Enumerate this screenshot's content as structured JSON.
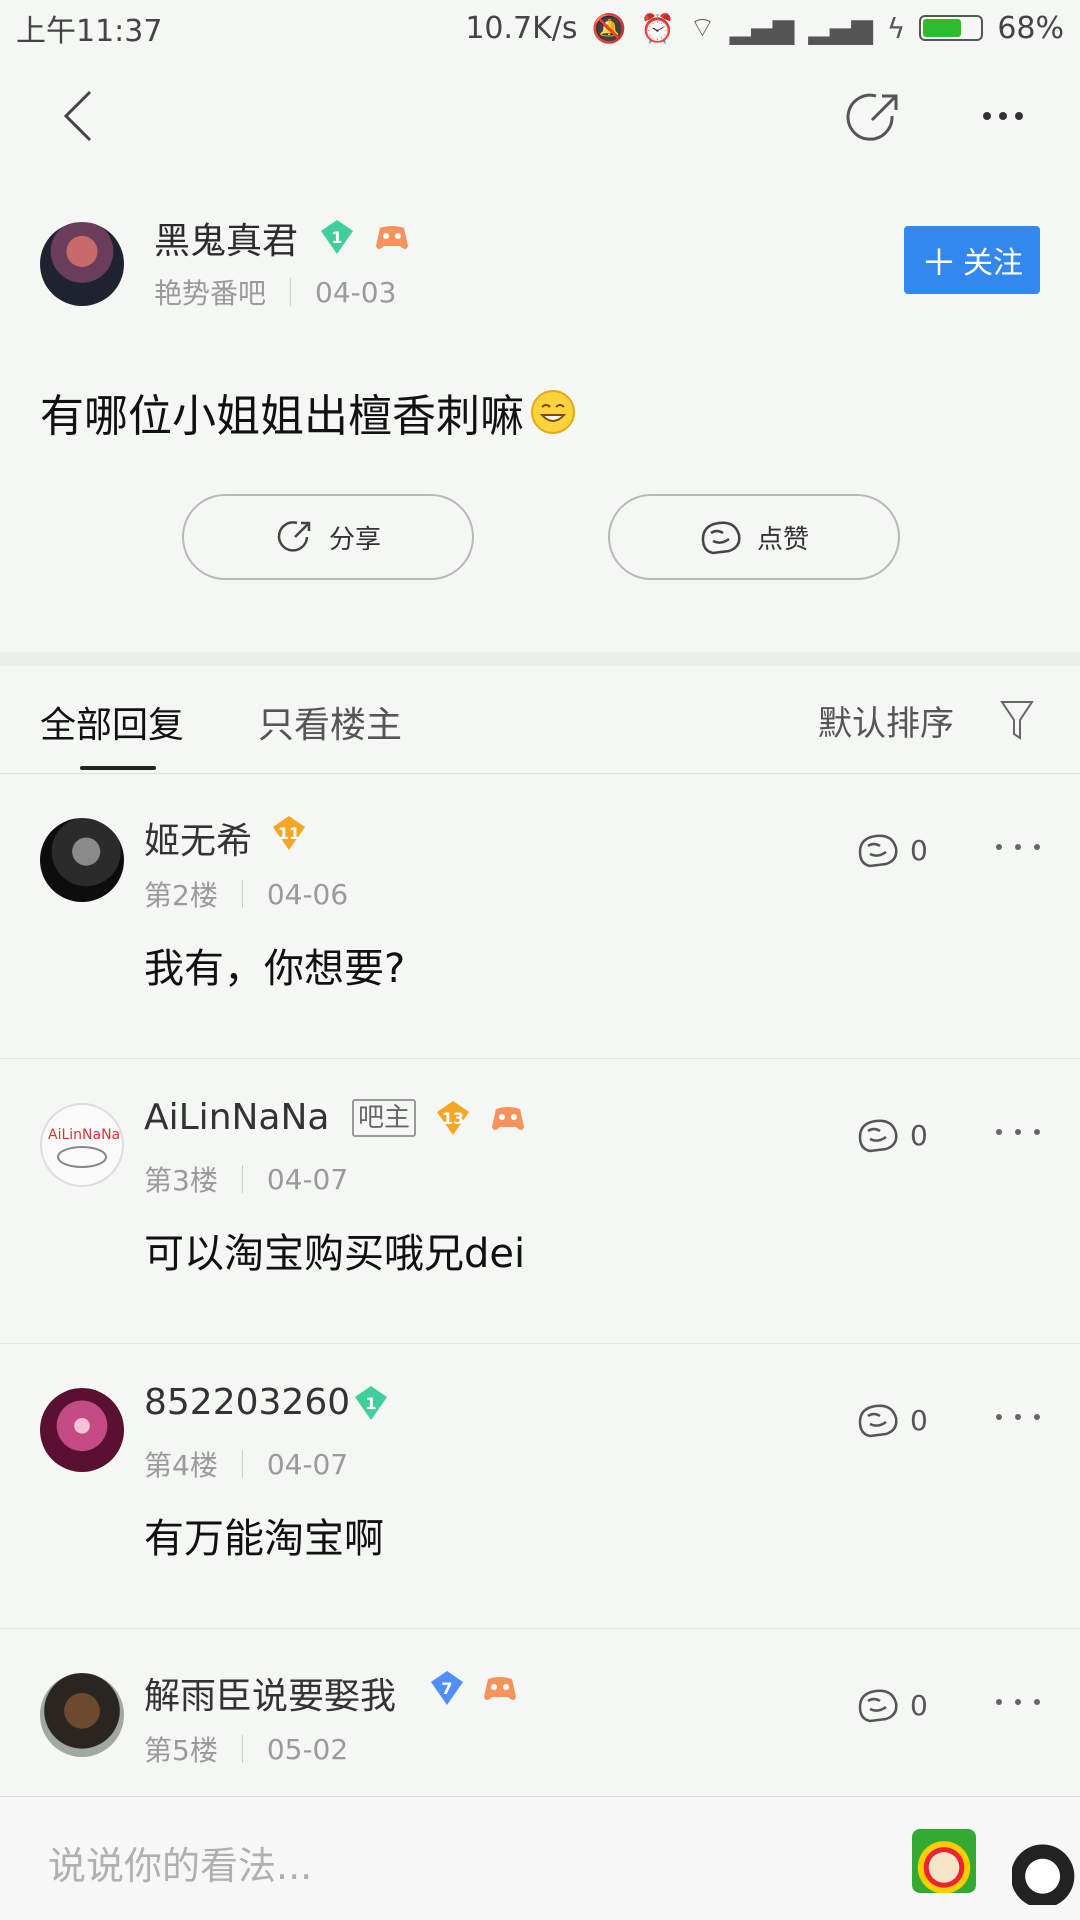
{
  "status_bar": {
    "time": "上午11:37",
    "speed": "10.7K/s",
    "battery": "68%",
    "battery_level": 0.68
  },
  "post": {
    "author": "黑鬼真君",
    "author_level": "1",
    "forum": "艳势番吧",
    "date": "04-03",
    "title": "有哪位小姐姐出檀香刺嘛",
    "follow_label": "关注",
    "share_label": "分享",
    "like_label": "点赞"
  },
  "tabs": {
    "all": "全部回复",
    "op_only": "只看楼主",
    "sort": "默认排序"
  },
  "replies": [
    {
      "name": "姬无希",
      "level": "11",
      "floor": "第2楼",
      "date": "04-06",
      "text": "我有，你想要?",
      "likes": "0"
    },
    {
      "name": "AiLinNaNa",
      "tag": "吧主",
      "level": "13",
      "floor": "第3楼",
      "date": "04-07",
      "text": "可以淘宝购买哦兄dei",
      "likes": "0"
    },
    {
      "name": "852203260",
      "level": "1",
      "floor": "第4楼",
      "date": "04-07",
      "text": "有万能淘宝啊",
      "likes": "0"
    },
    {
      "name": "解雨臣说要娶我",
      "level": "7",
      "floor": "第5楼",
      "date": "05-02",
      "text": "",
      "likes": "0"
    }
  ],
  "input": {
    "placeholder": "说说你的看法..."
  },
  "colors": {
    "accent": "#3388ee",
    "badge_green": "#3fcf9a",
    "badge_gold": "#f5a623",
    "badge_blue": "#4f8ff7"
  }
}
